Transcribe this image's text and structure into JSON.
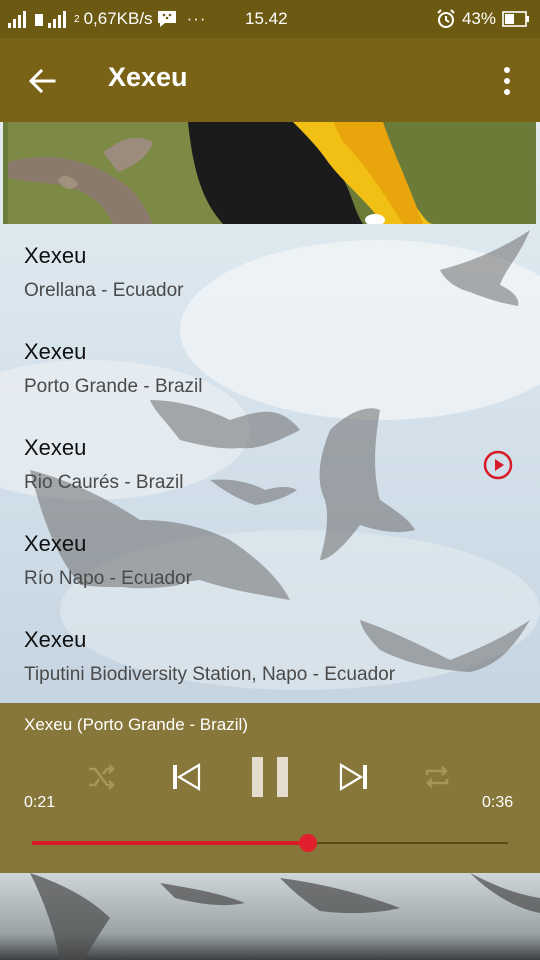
{
  "status_bar": {
    "network_speed": "0,67KB/s",
    "time": "15.42",
    "battery": "43%",
    "sim_label": "2"
  },
  "toolbar": {
    "title": "Xexeu"
  },
  "recordings": [
    {
      "name": "Xexeu",
      "location": "Orellana - Ecuador"
    },
    {
      "name": "Xexeu",
      "location": "Porto Grande - Brazil",
      "playing": true
    },
    {
      "name": "Xexeu",
      "location": "Rio Caurés - Brazil"
    },
    {
      "name": "Xexeu",
      "location": "Río Napo - Ecuador"
    },
    {
      "name": "Xexeu",
      "location": "Tiputini Biodiversity Station, Napo - Ecuador"
    }
  ],
  "player": {
    "now_playing": "Xexeu (Porto Grande - Brazil)",
    "current_time": "0:21",
    "total_time": "0:36",
    "progress": 0.58
  },
  "colors": {
    "toolbar": "#7a6316",
    "status_bar": "#6d5a12",
    "accent": "#d81b28"
  }
}
